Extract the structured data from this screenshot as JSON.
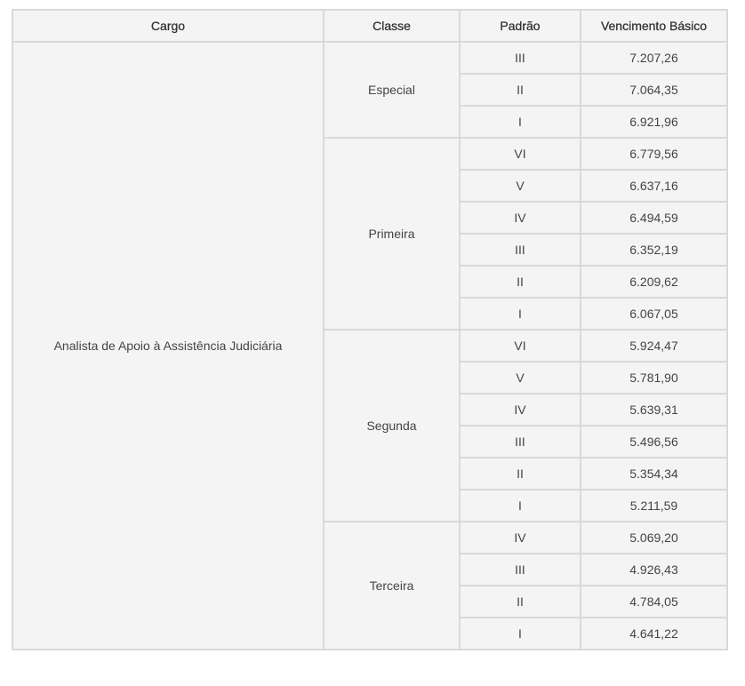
{
  "headers": [
    "Cargo",
    "Classe",
    "Padrão",
    "Vencimento Básico"
  ],
  "cargo": "Analista de Apoio à Assistência Judiciária",
  "classes": [
    {
      "name": "Especial",
      "rows": [
        {
          "padrao": "III",
          "vencimento": "7.207,26"
        },
        {
          "padrao": "II",
          "vencimento": "7.064,35"
        },
        {
          "padrao": "I",
          "vencimento": "6.921,96"
        }
      ]
    },
    {
      "name": "Primeira",
      "rows": [
        {
          "padrao": "VI",
          "vencimento": "6.779,56"
        },
        {
          "padrao": "V",
          "vencimento": "6.637,16"
        },
        {
          "padrao": "IV",
          "vencimento": "6.494,59"
        },
        {
          "padrao": "III",
          "vencimento": "6.352,19"
        },
        {
          "padrao": "II",
          "vencimento": "6.209,62"
        },
        {
          "padrao": "I",
          "vencimento": "6.067,05"
        }
      ]
    },
    {
      "name": "Segunda",
      "rows": [
        {
          "padrao": "VI",
          "vencimento": "5.924,47"
        },
        {
          "padrao": "V",
          "vencimento": "5.781,90"
        },
        {
          "padrao": "IV",
          "vencimento": "5.639,31"
        },
        {
          "padrao": "III",
          "vencimento": "5.496,56"
        },
        {
          "padrao": "II",
          "vencimento": "5.354,34"
        },
        {
          "padrao": "I",
          "vencimento": "5.211,59"
        }
      ]
    },
    {
      "name": "Terceira",
      "rows": [
        {
          "padrao": "IV",
          "vencimento": "5.069,20"
        },
        {
          "padrao": "III",
          "vencimento": "4.926,43"
        },
        {
          "padrao": "II",
          "vencimento": "4.784,05"
        },
        {
          "padrao": "I",
          "vencimento": "4.641,22"
        }
      ]
    }
  ]
}
